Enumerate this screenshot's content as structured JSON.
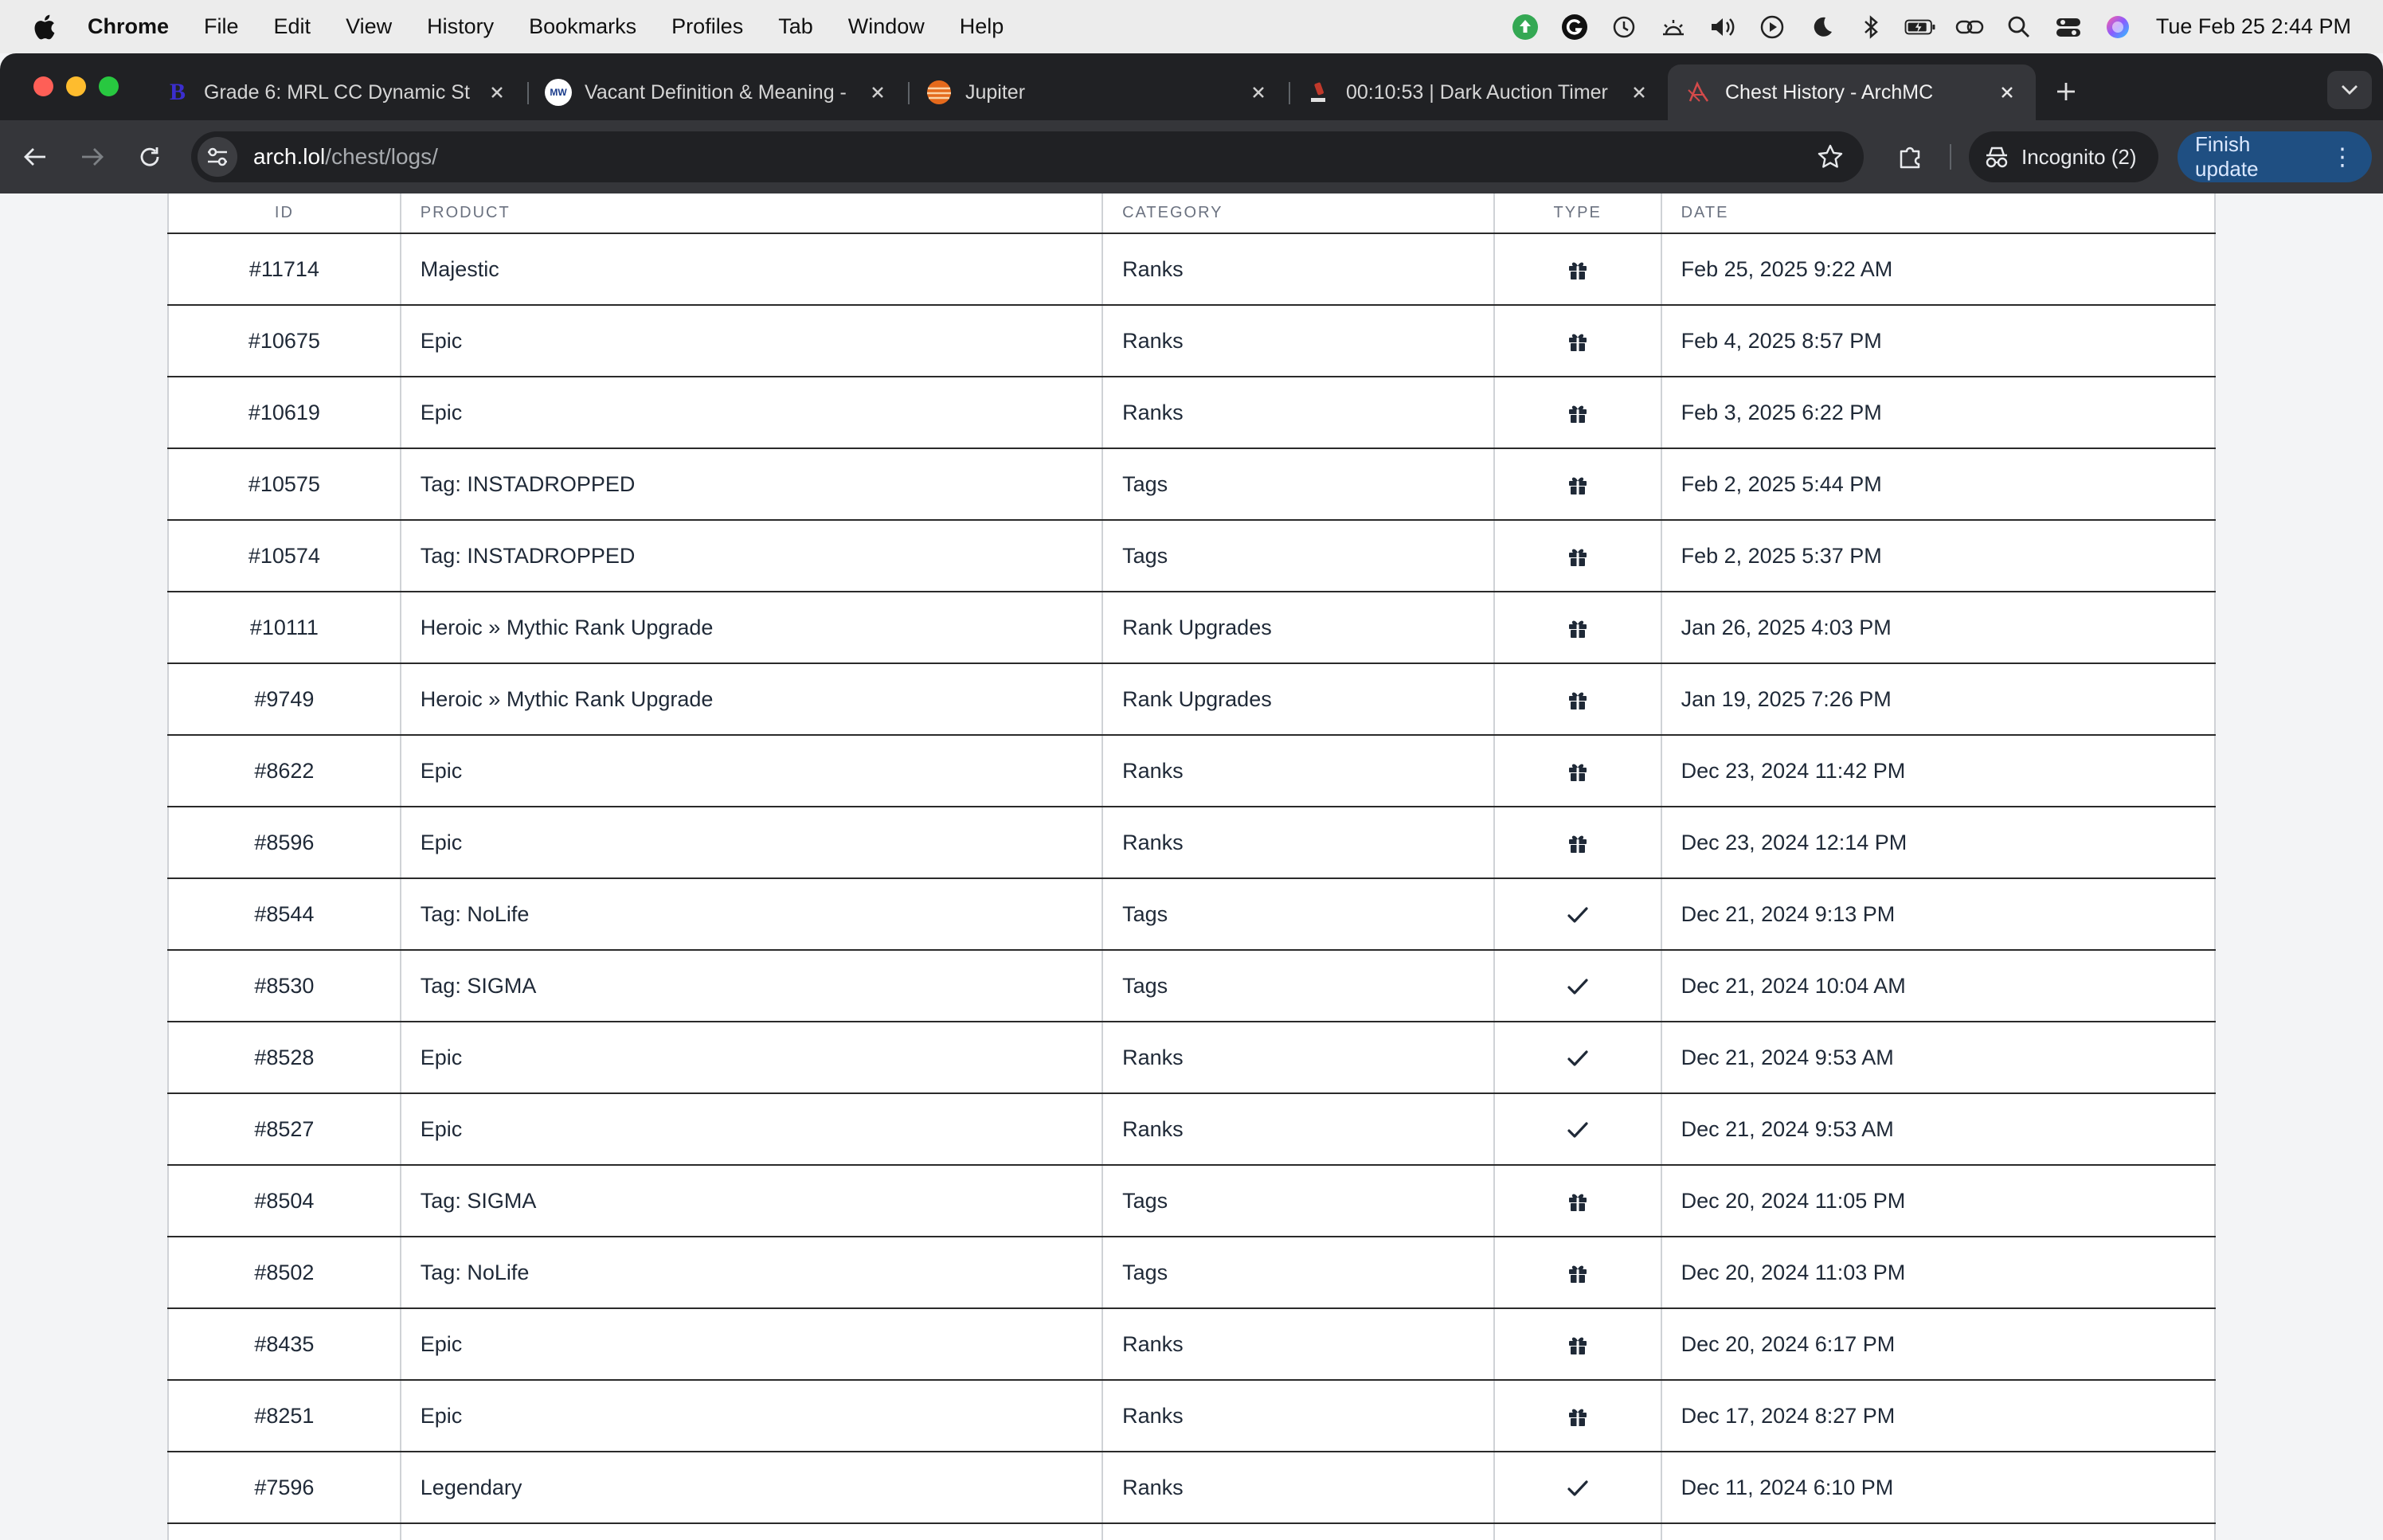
{
  "menubar": {
    "app": "Chrome",
    "items": [
      "File",
      "Edit",
      "View",
      "History",
      "Bookmarks",
      "Profiles",
      "Tab",
      "Window",
      "Help"
    ],
    "clock": "Tue Feb 25  2:44 PM"
  },
  "tabs": [
    {
      "title": "Grade 6: MRL CC Dynamic St",
      "favicon": "B",
      "favicon_color": "#3b2ecf",
      "active": false
    },
    {
      "title": "Vacant Definition & Meaning -",
      "favicon": "MW",
      "favicon_color": "#ffffff",
      "active": false
    },
    {
      "title": "Jupiter",
      "favicon": "",
      "favicon_color": "#e56a1c",
      "active": false
    },
    {
      "title": "00:10:53 | Dark Auction Timer",
      "favicon": "",
      "favicon_color": "#c0392b",
      "active": false
    },
    {
      "title": "Chest History - ArchMC",
      "favicon": "",
      "favicon_color": "#c0392b",
      "active": true
    }
  ],
  "toolbar": {
    "url_host": "arch.lol",
    "url_path": "/chest/logs/",
    "incognito_label": "Incognito (2)",
    "finish_label": "Finish update"
  },
  "table": {
    "headers": {
      "id": "ID",
      "product": "PRODUCT",
      "category": "CATEGORY",
      "type": "TYPE",
      "date": "DATE"
    },
    "rows": [
      {
        "id": "#11714",
        "product": "Majestic",
        "category": "Ranks",
        "type": "gift",
        "date": "Feb 25, 2025 9:22 AM"
      },
      {
        "id": "#10675",
        "product": "Epic",
        "category": "Ranks",
        "type": "gift",
        "date": "Feb 4, 2025 8:57 PM"
      },
      {
        "id": "#10619",
        "product": "Epic",
        "category": "Ranks",
        "type": "gift",
        "date": "Feb 3, 2025 6:22 PM"
      },
      {
        "id": "#10575",
        "product": "Tag: INSTADROPPED",
        "category": "Tags",
        "type": "gift",
        "date": "Feb 2, 2025 5:44 PM"
      },
      {
        "id": "#10574",
        "product": "Tag: INSTADROPPED",
        "category": "Tags",
        "type": "gift",
        "date": "Feb 2, 2025 5:37 PM"
      },
      {
        "id": "#10111",
        "product": "Heroic » Mythic Rank Upgrade",
        "category": "Rank Upgrades",
        "type": "gift",
        "date": "Jan 26, 2025 4:03 PM"
      },
      {
        "id": "#9749",
        "product": "Heroic » Mythic Rank Upgrade",
        "category": "Rank Upgrades",
        "type": "gift",
        "date": "Jan 19, 2025 7:26 PM"
      },
      {
        "id": "#8622",
        "product": "Epic",
        "category": "Ranks",
        "type": "gift",
        "date": "Dec 23, 2024 11:42 PM"
      },
      {
        "id": "#8596",
        "product": "Epic",
        "category": "Ranks",
        "type": "gift",
        "date": "Dec 23, 2024 12:14 PM"
      },
      {
        "id": "#8544",
        "product": "Tag: NoLife",
        "category": "Tags",
        "type": "check",
        "date": "Dec 21, 2024 9:13 PM"
      },
      {
        "id": "#8530",
        "product": "Tag: SIGMA",
        "category": "Tags",
        "type": "check",
        "date": "Dec 21, 2024 10:04 AM"
      },
      {
        "id": "#8528",
        "product": "Epic",
        "category": "Ranks",
        "type": "check",
        "date": "Dec 21, 2024 9:53 AM"
      },
      {
        "id": "#8527",
        "product": "Epic",
        "category": "Ranks",
        "type": "check",
        "date": "Dec 21, 2024 9:53 AM"
      },
      {
        "id": "#8504",
        "product": "Tag: SIGMA",
        "category": "Tags",
        "type": "gift",
        "date": "Dec 20, 2024 11:05 PM"
      },
      {
        "id": "#8502",
        "product": "Tag: NoLife",
        "category": "Tags",
        "type": "gift",
        "date": "Dec 20, 2024 11:03 PM"
      },
      {
        "id": "#8435",
        "product": "Epic",
        "category": "Ranks",
        "type": "gift",
        "date": "Dec 20, 2024 6:17 PM"
      },
      {
        "id": "#8251",
        "product": "Epic",
        "category": "Ranks",
        "type": "gift",
        "date": "Dec 17, 2024 8:27 PM"
      },
      {
        "id": "#7596",
        "product": "Legendary",
        "category": "Ranks",
        "type": "check",
        "date": "Dec 11, 2024 6:10 PM"
      },
      {
        "id": "",
        "product": "",
        "category": "",
        "type": "",
        "date": ""
      }
    ]
  }
}
